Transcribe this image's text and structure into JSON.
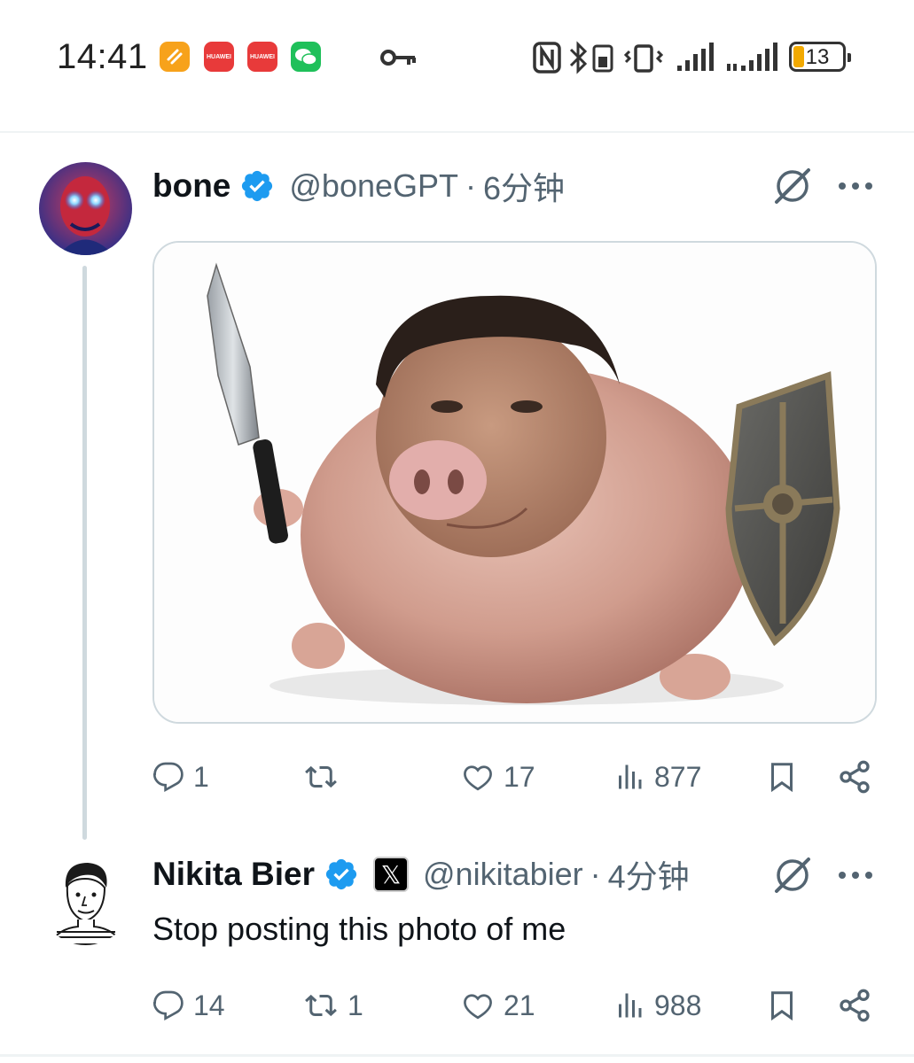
{
  "status_bar": {
    "time": "14:41",
    "battery": "13",
    "app_icons": [
      "orange-app-icon",
      "huawei-app-icon",
      "huawei-app-icon",
      "wechat-icon"
    ],
    "huawei_label": "HUAWEI"
  },
  "tweets": [
    {
      "name": "bone",
      "handle": "@boneGPT",
      "separator": "·",
      "time": "6分钟",
      "verified": true,
      "actions": {
        "replies": "1",
        "reposts": "",
        "likes": "17",
        "views": "877"
      }
    },
    {
      "name": "Nikita Bier",
      "handle": "@nikitabier",
      "separator": "·",
      "time": "4分钟",
      "verified": true,
      "affiliate_badge": "𝕏",
      "text": "Stop posting this photo of me",
      "actions": {
        "replies": "14",
        "reposts": "1",
        "likes": "21",
        "views": "988"
      }
    }
  ],
  "colors": {
    "verified_blue": "#1d9bf0",
    "secondary_text": "#536471",
    "divider": "#eff3f4"
  }
}
